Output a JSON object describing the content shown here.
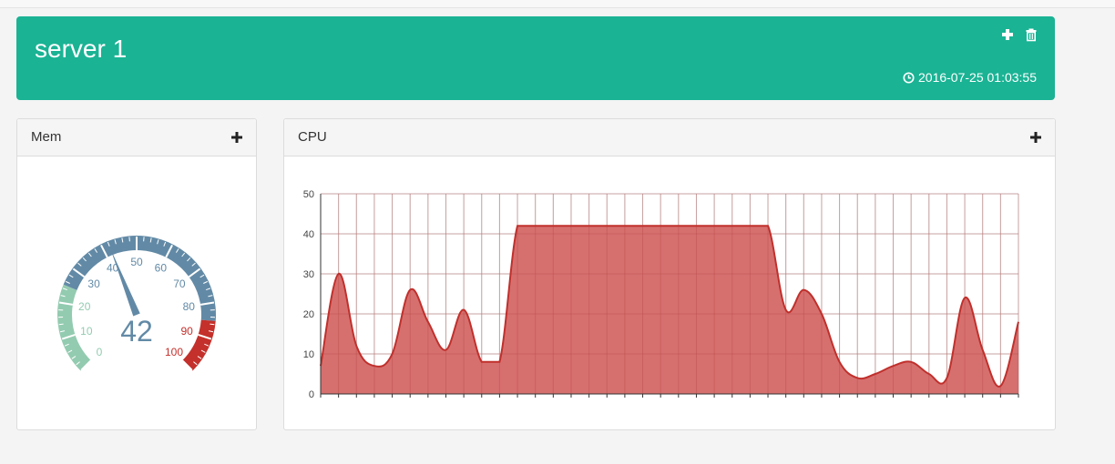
{
  "server": {
    "title": "server 1",
    "timestamp": "2016-07-25 01:03:55"
  },
  "mem": {
    "title": "Mem",
    "value": 42,
    "value_label": "42",
    "min": 0,
    "max": 100,
    "tick_labels": [
      "0",
      "10",
      "20",
      "30",
      "40",
      "50",
      "60",
      "70",
      "80",
      "90",
      "100"
    ],
    "colors": {
      "low": "#93cbb0",
      "mid": "#628aa6",
      "high": "#c4302b"
    }
  },
  "cpu": {
    "title": "CPU",
    "chart_data": {
      "type": "area",
      "ylim": [
        0,
        50
      ],
      "yticks": [
        "0",
        "10",
        "20",
        "30",
        "40",
        "50"
      ],
      "color": "#d2615f",
      "values": [
        7,
        30,
        12,
        7,
        10,
        26,
        18,
        11,
        21,
        8,
        8,
        42,
        42,
        42,
        42,
        42,
        42,
        42,
        42,
        42,
        42,
        42,
        42,
        42,
        42,
        42,
        21,
        26,
        20,
        8,
        4,
        5,
        7,
        8,
        5,
        4,
        24,
        11,
        2,
        18
      ]
    }
  },
  "colors": {
    "header": "#1ab394"
  }
}
